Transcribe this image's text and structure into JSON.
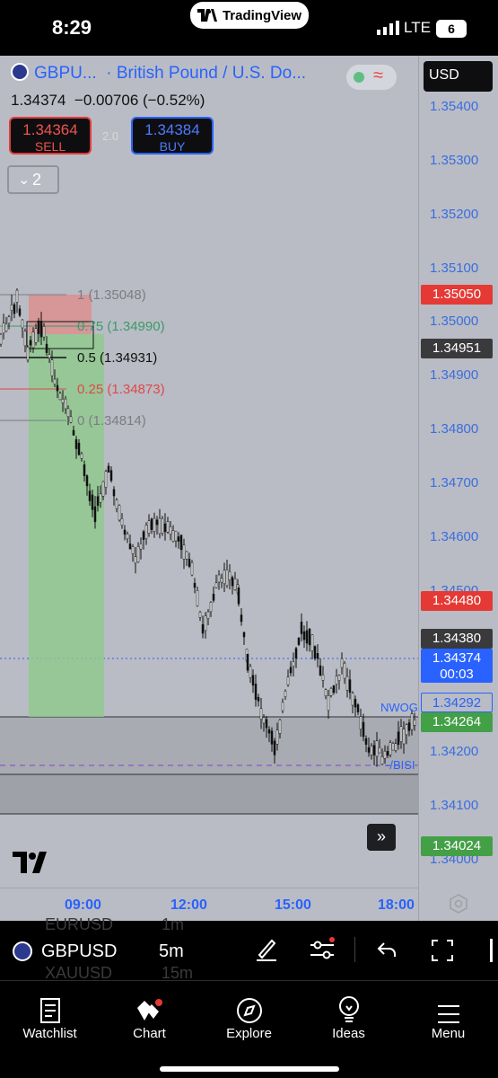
{
  "status_bar": {
    "time": "8:29",
    "app_pill": "TradingView",
    "carrier": "LTE",
    "battery": "6"
  },
  "header": {
    "symbol_short": "GBPU...",
    "symbol_name": "British Pound / U.S. Do...",
    "price": "1.34374",
    "change": "−0.00706 (−0.52%)",
    "sell_price": "1.34364",
    "sell_label": "SELL",
    "buy_price": "1.34384",
    "buy_label": "BUY",
    "spread": "2.0",
    "collapse_count": "2",
    "currency": "USD"
  },
  "price_axis": {
    "ticks": [
      "1.35400",
      "1.35300",
      "1.35200",
      "1.35100",
      "1.35000",
      "1.34900",
      "1.34800",
      "1.34700",
      "1.34600",
      "1.34500",
      "1.34200",
      "1.34100",
      "1.34000"
    ],
    "tags": [
      {
        "value": "1.35050",
        "color": "#e53935"
      },
      {
        "value": "1.34951",
        "color": "#3a3a3c"
      },
      {
        "value": "1.34480",
        "color": "#e53935"
      },
      {
        "value": "1.34380",
        "color": "#3a3a3c"
      },
      {
        "value": "1.34374",
        "color": "#2962ff"
      },
      {
        "value": "1.34292",
        "color": "#b9bcc4"
      },
      {
        "value": "1.34264",
        "color": "#43a047"
      },
      {
        "value": "1.34024",
        "color": "#43a047"
      }
    ],
    "countdown": "00:03"
  },
  "fib_levels": [
    {
      "label": "1 (1.35048)",
      "color": "#7a7d84"
    },
    {
      "label": "0.75 (1.34990)",
      "color": "#3c9a6a"
    },
    {
      "label": "0.5 (1.34931)",
      "color": "#111111"
    },
    {
      "label": "0.25 (1.34873)",
      "color": "#e04848"
    },
    {
      "label": "0 (1.34814)",
      "color": "#7a7d84"
    }
  ],
  "chart_annotations": {
    "nwog": "NWOG",
    "bisi": "-/BISI"
  },
  "time_axis": {
    "labels": [
      "09:00",
      "12:00",
      "15:00",
      "18:00"
    ]
  },
  "bottom_toolbar": {
    "symbol": "GBPUSD",
    "interval": "5m",
    "ghost_symbol_1": "EURUSD",
    "ghost_interval_1": "1m",
    "ghost_symbol_2": "XAUUSD",
    "ghost_interval_2": "15m"
  },
  "tabs": [
    {
      "label": "Watchlist",
      "icon": "watchlist-icon"
    },
    {
      "label": "Chart",
      "icon": "chart-icon"
    },
    {
      "label": "Explore",
      "icon": "compass-icon"
    },
    {
      "label": "Ideas",
      "icon": "lightbulb-icon"
    },
    {
      "label": "Menu",
      "icon": "menu-icon"
    }
  ]
}
